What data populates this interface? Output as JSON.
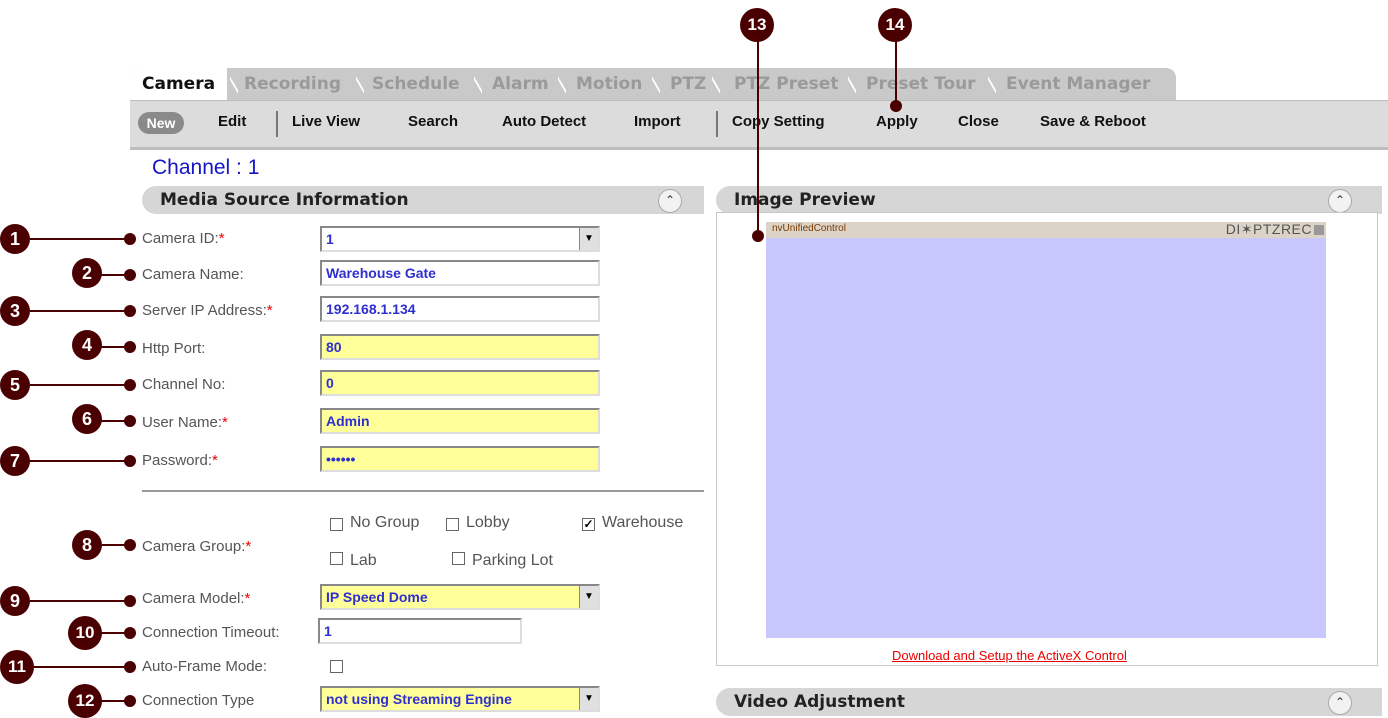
{
  "tabs": [
    {
      "label": "Camera",
      "active": true
    },
    {
      "label": "Recording",
      "active": false
    },
    {
      "label": "Schedule",
      "active": false
    },
    {
      "label": "Alarm",
      "active": false
    },
    {
      "label": "Motion",
      "active": false
    },
    {
      "label": "PTZ",
      "active": false
    },
    {
      "label": "PTZ Preset",
      "active": false
    },
    {
      "label": "Preset Tour",
      "active": false
    },
    {
      "label": "Event Manager",
      "active": false
    }
  ],
  "toolbar": {
    "new": "New",
    "edit": "Edit",
    "live_view": "Live View",
    "search": "Search",
    "auto_detect": "Auto Detect",
    "import": "Import",
    "copy_setting": "Copy Setting",
    "apply": "Apply",
    "close": "Close",
    "save_reboot": "Save & Reboot"
  },
  "channel_title": "Channel : 1",
  "media_source": {
    "title": "Media Source Information",
    "camera_id": {
      "label": "Camera ID:",
      "value": "1",
      "required": "*"
    },
    "camera_name": {
      "label": "Camera Name:",
      "value": "Warehouse Gate"
    },
    "server_ip": {
      "label": "Server IP Address:",
      "value": "192.168.1.134",
      "required": "*"
    },
    "http_port": {
      "label": "Http Port:",
      "value": "80"
    },
    "channel_no": {
      "label": "Channel No:",
      "value": "0"
    },
    "user_name": {
      "label": "User Name:",
      "value": "Admin",
      "required": "*"
    },
    "password": {
      "label": "Password:",
      "value": "••••••",
      "required": "*"
    },
    "camera_group": {
      "label": "Camera Group:",
      "required": "*",
      "options": [
        {
          "label": "No Group",
          "checked": false
        },
        {
          "label": "Lobby",
          "checked": false
        },
        {
          "label": "Warehouse",
          "checked": true
        },
        {
          "label": "Lab",
          "checked": false
        },
        {
          "label": "Parking Lot",
          "checked": false
        }
      ]
    },
    "camera_model": {
      "label": "Camera Model:",
      "value": "IP Speed Dome",
      "required": "*"
    },
    "connection_timeout": {
      "label": "Connection Timeout:",
      "value": "1"
    },
    "auto_frame": {
      "label": "Auto-Frame Mode:",
      "checked": false
    },
    "connection_type": {
      "label": "Connection Type",
      "value": "not using Streaming Engine"
    }
  },
  "image_preview": {
    "title": "Image Preview",
    "control_name": "nvUnifiedControl",
    "control_status": "DI✶PTZREC",
    "download_link": "Download and Setup the ActiveX Control"
  },
  "video_adjustment": {
    "title": "Video Adjustment"
  },
  "callouts": [
    "1",
    "2",
    "3",
    "4",
    "5",
    "6",
    "7",
    "8",
    "9",
    "10",
    "11",
    "12",
    "13",
    "14"
  ],
  "colors": {
    "callout": "#4a0000",
    "input_highlight": "#ffff99",
    "preview_bg": "#c8c8ff",
    "value_text": "#2f2fd0"
  }
}
